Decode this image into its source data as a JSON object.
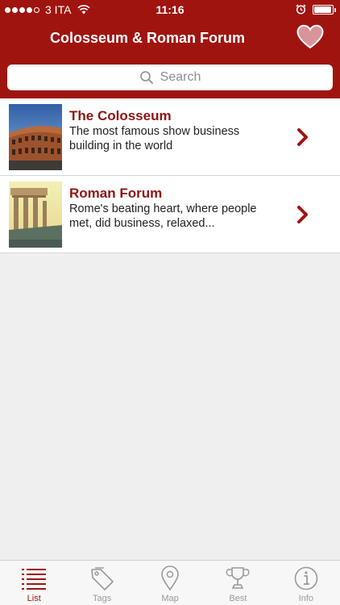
{
  "status_bar": {
    "carrier": "3 ITA",
    "time": "11:16",
    "signal_bars": 4,
    "battery_level": 0.95
  },
  "nav": {
    "title": "Colosseum & Roman Forum",
    "favorite_icon": "heart-icon"
  },
  "search": {
    "placeholder": "Search"
  },
  "items": [
    {
      "title": "The Colosseum",
      "description": "The most famous show business building in the world"
    },
    {
      "title": "Roman Forum",
      "description": "Rome's beating heart, where people met, did business, relaxed..."
    }
  ],
  "tabs": [
    {
      "label": "List",
      "icon": "list-icon",
      "active": true
    },
    {
      "label": "Tags",
      "icon": "tag-icon",
      "active": false
    },
    {
      "label": "Map",
      "icon": "map-pin-icon",
      "active": false
    },
    {
      "label": "Best",
      "icon": "trophy-icon",
      "active": false
    },
    {
      "label": "Info",
      "icon": "info-icon",
      "active": false
    }
  ],
  "colors": {
    "brand": "#a0140f",
    "title_text": "#8f1512",
    "tab_active": "#9e1611",
    "tab_inactive": "#999999"
  }
}
